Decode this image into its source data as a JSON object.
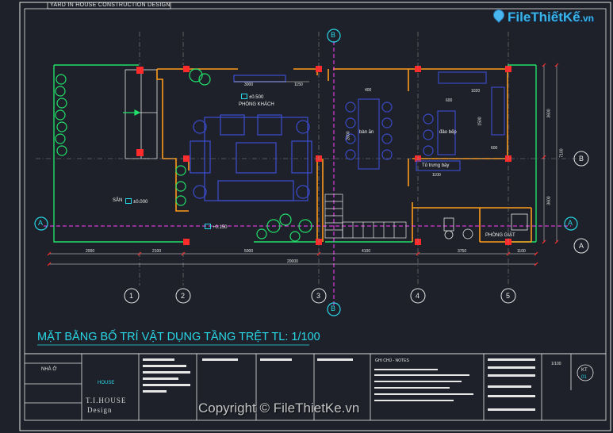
{
  "sheet": {
    "title": "YARD IN HOUSE CONSTRUCTION DESIGN"
  },
  "plan": {
    "title": "MẶT BẰNG BỐ TRÍ VẬT DỤNG TẦNG TRỆT  TL: 1/100",
    "rooms": {
      "living": "PHÒNG KHÁCH",
      "dining": "bàn ăn",
      "kitchen": "đảo bếp",
      "display_cabinet": "Tủ trưng bày",
      "yard": "SÂN",
      "laundry": "PHÒNG GIẶT"
    },
    "levels": {
      "living": "±0.500",
      "yard": "±0.000",
      "side_yard": "+0.150"
    },
    "dims_bottom": [
      "2000",
      "2100",
      "5000",
      "4100",
      "3750",
      "1100"
    ],
    "dim_total": "20000",
    "dims_top": [
      "3000",
      "1150"
    ],
    "dims_right": [
      "3600",
      "7100",
      "3600"
    ],
    "dims_kitchen": [
      "1020",
      "600",
      "1500"
    ],
    "dims_misc": [
      "400",
      "2600",
      "600",
      "1100"
    ],
    "grid_numbers": [
      "1",
      "2",
      "3",
      "4",
      "5"
    ],
    "section_letters": {
      "a": "A",
      "b": "B"
    }
  },
  "title_block": {
    "project": "NHÀ Ở",
    "company": "T.I.HOUSE",
    "company_sub": "Design",
    "notes_label": "GHI CHÚ - NOTES",
    "scale": "1/100",
    "sheet_no": "KT",
    "sheet_num": "01",
    "logo_small": "HOUSE"
  },
  "branding": {
    "logo": "FileThiếtKế",
    "logo_suffix": ".vn",
    "watermark": "Copyright © FileThietKe.vn"
  },
  "colors": {
    "background": "#1e2129",
    "cyan": "#29d8e8",
    "magenta": "#ff40ff",
    "orange": "#ff9a1a",
    "green": "#22e06a",
    "red": "#ff2a2a",
    "blue_furniture": "#3a4ac8"
  }
}
